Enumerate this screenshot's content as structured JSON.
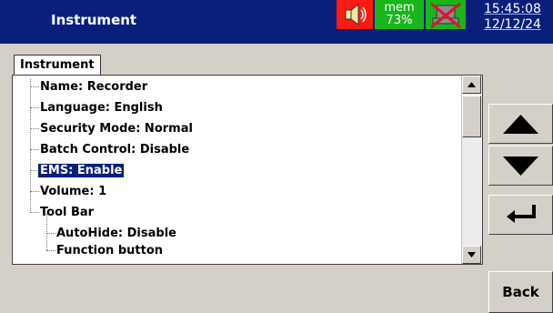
{
  "header": {
    "title": "Instrument",
    "mem_label": "mem",
    "mem_value": "73%",
    "time": "15:45:08",
    "date": "12/12/24",
    "icons": [
      "speaker-icon",
      "network-disconnected-icon"
    ],
    "colors": {
      "titlebar": "#0a1f7a",
      "speaker_bg": "#ff1a10",
      "status_bg": "#19b51b"
    }
  },
  "tab": {
    "label": "Instrument"
  },
  "tree": {
    "items": [
      {
        "label": "Name: Recorder",
        "level": 0
      },
      {
        "label": "Language: English",
        "level": 0
      },
      {
        "label": "Security Mode: Normal",
        "level": 0
      },
      {
        "label": "Batch Control: Disable",
        "level": 0
      },
      {
        "label": "EMS: Enable",
        "level": 0,
        "selected": true
      },
      {
        "label": "Volume: 1",
        "level": 0
      },
      {
        "label": "Tool Bar",
        "level": 0
      },
      {
        "label": "AutoHide: Disable",
        "level": 1
      },
      {
        "label": "Function button",
        "level": 1
      }
    ]
  },
  "buttons": {
    "up": "up-arrow-icon",
    "down": "down-arrow-icon",
    "enter": "enter-icon",
    "back": "Back"
  }
}
